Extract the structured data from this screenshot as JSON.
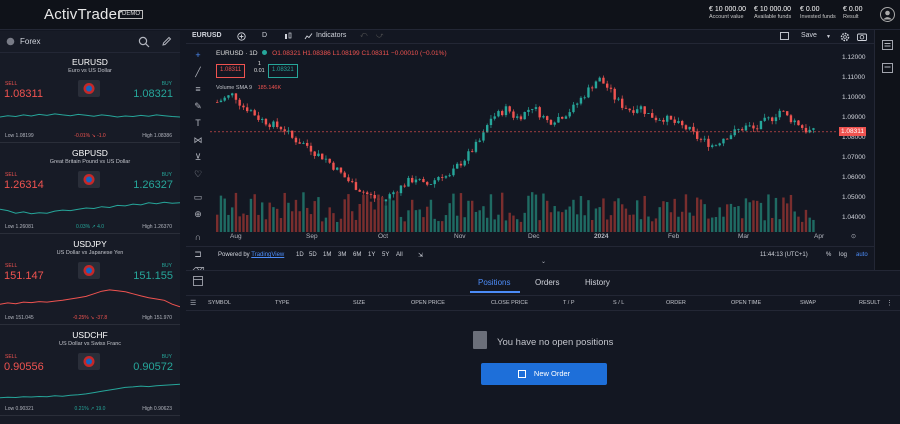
{
  "header": {
    "logo": "ActivTrader",
    "demo_badge": "DEMO",
    "account_value": "€ 10 000.00",
    "account_value_label": "Account value",
    "available_funds": "€ 10 000.00",
    "available_funds_label": "Available funds",
    "invested_funds": "€ 0.00",
    "invested_funds_label": "Invested funds",
    "result": "€ 0.00",
    "result_label": "Result"
  },
  "sidebar": {
    "title": "Forex",
    "cards": [
      {
        "symbol": "EURUSD",
        "name": "Euro vs US Dollar",
        "sell_label": "SELL",
        "buy_label": "BUY",
        "sell": "1.08311",
        "buy": "1.08321",
        "low": "Low 1.08199",
        "change": "-0.01% ↘ -1.0",
        "high": "High 1.08386",
        "change_color": "#ef5350",
        "spark_color": "#26a69a",
        "spark": [
          0.5,
          0.55,
          0.52,
          0.58,
          0.54,
          0.6,
          0.56,
          0.62,
          0.58,
          0.55,
          0.6,
          0.57,
          0.53,
          0.58,
          0.55,
          0.5,
          0.54,
          0.52,
          0.56,
          0.53,
          0.58,
          0.55,
          0.52,
          0.5
        ]
      },
      {
        "symbol": "GBPUSD",
        "name": "Great Britain Pound vs US Dollar",
        "sell_label": "SELL",
        "buy_label": "BUY",
        "sell": "1.26314",
        "buy": "1.26327",
        "low": "Low 1.26081",
        "change": "0.03% ↗ 4.0",
        "high": "High 1.26370",
        "change_color": "#26a69a",
        "spark_color": "#26a69a",
        "spark": [
          0.45,
          0.4,
          0.3,
          0.35,
          0.28,
          0.32,
          0.3,
          0.38,
          0.42,
          0.4,
          0.45,
          0.5,
          0.48,
          0.55,
          0.52,
          0.6,
          0.58,
          0.65,
          0.62,
          0.7,
          0.66,
          0.72,
          0.68,
          0.7
        ]
      },
      {
        "symbol": "USDJPY",
        "name": "US Dollar vs Japanese Yen",
        "sell_label": "SELL",
        "buy_label": "BUY",
        "sell": "151.147",
        "buy": "151.155",
        "low": "Low 151.045",
        "change": "-0.25% ↘ -37.8",
        "high": "High 151.970",
        "change_color": "#ef5350",
        "spark_color": "#ef5350",
        "spark": [
          0.3,
          0.35,
          0.32,
          0.38,
          0.36,
          0.4,
          0.38,
          0.42,
          0.45,
          0.5,
          0.55,
          0.6,
          0.7,
          0.8,
          0.85,
          0.82,
          0.78,
          0.7,
          0.62,
          0.55,
          0.5,
          0.45,
          0.3,
          0.2
        ]
      },
      {
        "symbol": "USDCHF",
        "name": "US Dollar vs Swiss Franc",
        "sell_label": "SELL",
        "buy_label": "BUY",
        "sell": "0.90556",
        "buy": "0.90572",
        "low": "Low 0.90321",
        "change": "0.21% ↗ 19.0",
        "high": "High 0.90623",
        "change_color": "#26a69a",
        "spark_color": "#26a69a",
        "spark": [
          0.2,
          0.22,
          0.21,
          0.24,
          0.23,
          0.25,
          0.24,
          0.28,
          0.26,
          0.3,
          0.32,
          0.35,
          0.4,
          0.45,
          0.5,
          0.55,
          0.6,
          0.62,
          0.65,
          0.63,
          0.66,
          0.68,
          0.7,
          0.72
        ]
      }
    ]
  },
  "toolbar": {
    "symbol": "EURUSD",
    "interval": "D",
    "indicators": "Indicators",
    "save": "Save"
  },
  "legend": {
    "title": "EURUSD · 1D",
    "ohlc": "O1.08321 H1.08386 L1.08199 C1.08311 −0.00010 (−0.01%)",
    "sell_box": "1.08311",
    "spread_top": "1",
    "spread_bot": "0.01",
    "buy_box": "1.08321",
    "volume": "Volume  SMA 9",
    "volume_value": "185.146K"
  },
  "price_axis": [
    "1.12000",
    "1.11000",
    "1.10000",
    "1.09000",
    "1.08000",
    "1.07000",
    "1.06000",
    "1.05000",
    "1.04000"
  ],
  "current_price": "1.08311",
  "time_axis": [
    "Aug",
    "Sep",
    "Oct",
    "Nov",
    "Dec",
    "2024",
    "Feb",
    "Mar",
    "Apr"
  ],
  "range": {
    "powered": "Powered by ",
    "powered_link": "TradingView",
    "buttons": [
      "1D",
      "5D",
      "1M",
      "3M",
      "6M",
      "1Y",
      "5Y",
      "All"
    ],
    "time": "11:44:13 (UTC+1)",
    "pct": "%",
    "log": "log",
    "auto": "auto"
  },
  "panel": {
    "tabs": [
      "Positions",
      "Orders",
      "History"
    ],
    "columns": [
      "SYMBOL",
      "TYPE",
      "SIZE",
      "OPEN PRICE",
      "CLOSE PRICE",
      "T / P",
      "S / L",
      "ORDER",
      "OPEN TIME",
      "SWAP",
      "RESULT"
    ],
    "empty": "You have no open positions",
    "new_order": "New Order"
  },
  "chart_data": {
    "type": "candlestick",
    "symbol": "EURUSD",
    "interval": "1D",
    "x": [
      "Aug",
      "Sep",
      "Oct",
      "Nov",
      "Dec",
      "2024",
      "Feb",
      "Mar",
      "Apr"
    ],
    "close_path": [
      1.098,
      1.1,
      1.102,
      1.096,
      1.094,
      1.09,
      1.088,
      1.086,
      1.085,
      1.08,
      1.078,
      1.076,
      1.072,
      1.07,
      1.066,
      1.062,
      1.058,
      1.055,
      1.052,
      1.05,
      1.048,
      1.052,
      1.055,
      1.058,
      1.06,
      1.056,
      1.058,
      1.062,
      1.06,
      1.066,
      1.07,
      1.075,
      1.08,
      1.09,
      1.092,
      1.095,
      1.09,
      1.092,
      1.096,
      1.092,
      1.088,
      1.09,
      1.092,
      1.095,
      1.1,
      1.105,
      1.11,
      1.106,
      1.1,
      1.096,
      1.094,
      1.096,
      1.092,
      1.09,
      1.09,
      1.088,
      1.086,
      1.084,
      1.08,
      1.078,
      1.076,
      1.08,
      1.082,
      1.084,
      1.086,
      1.084,
      1.088,
      1.09,
      1.094,
      1.09,
      1.088,
      1.084,
      1.083
    ],
    "ylim": [
      1.035,
      1.125
    ],
    "current": 1.08311
  }
}
